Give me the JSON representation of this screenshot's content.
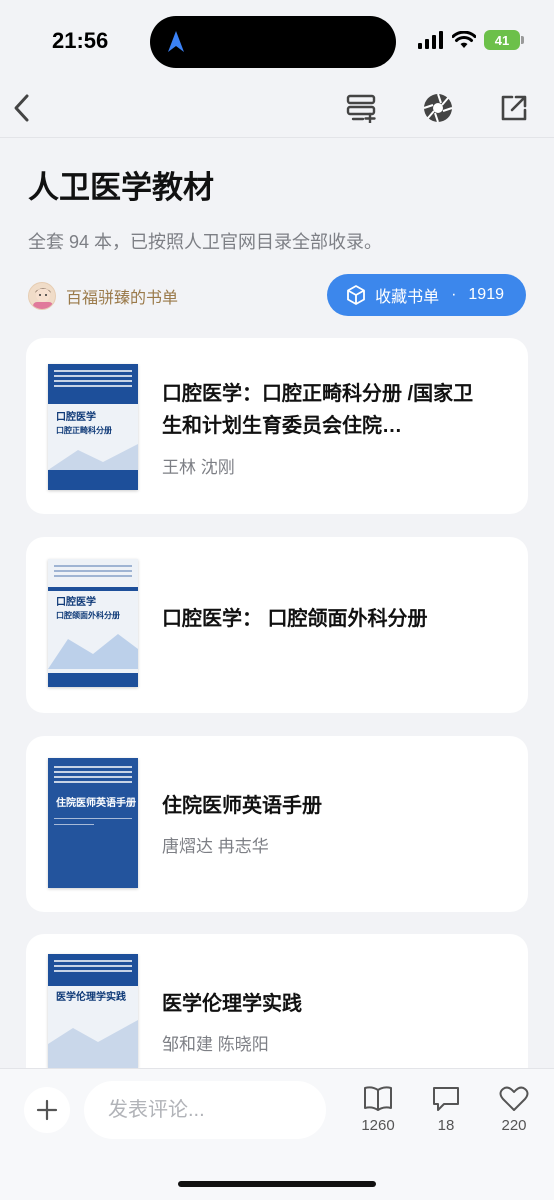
{
  "status_bar": {
    "time": "21:56",
    "battery": "41",
    "icons": [
      "location-arrow-icon",
      "signal-icon",
      "wifi-icon",
      "battery-icon"
    ]
  },
  "nav": {
    "icons": [
      "back-icon",
      "add-to-list-icon",
      "shutter-icon",
      "share-icon"
    ]
  },
  "header": {
    "title": "人卫医学教材",
    "subtitle": "全套 94 本，已按照人卫官网目录全部收录。",
    "author": "百福骈臻的书单",
    "favorite_label": "收藏书单",
    "favorite_sep": "·",
    "favorite_count": "1919"
  },
  "books": [
    {
      "title": "口腔医学：口腔正畸科分册 /国家卫生和计划生育委员会住院…",
      "author": "王林 沈刚",
      "cover_title": "口腔医学",
      "cover_subtitle": "口腔正畸科分册"
    },
    {
      "title": "口腔医学： 口腔颌面外科分册",
      "author": "",
      "cover_title": "口腔医学",
      "cover_subtitle": "口腔颌面外科分册"
    },
    {
      "title": "住院医师英语手册",
      "author": "唐熠达 冉志华",
      "cover_title": "住院医师英语手册",
      "cover_subtitle": ""
    },
    {
      "title": "医学伦理学实践",
      "author": "邹和建 陈晓阳",
      "cover_title": "医学伦理学实践",
      "cover_subtitle": ""
    }
  ],
  "bottom_bar": {
    "comment_placeholder": "发表评论...",
    "reads": "1260",
    "comments": "18",
    "likes": "220"
  },
  "colors": {
    "accent": "#3c87ec",
    "cover_blue": "#1d4f9a",
    "author_gold": "#9a7a4a",
    "battery_green": "#6cc04a"
  }
}
